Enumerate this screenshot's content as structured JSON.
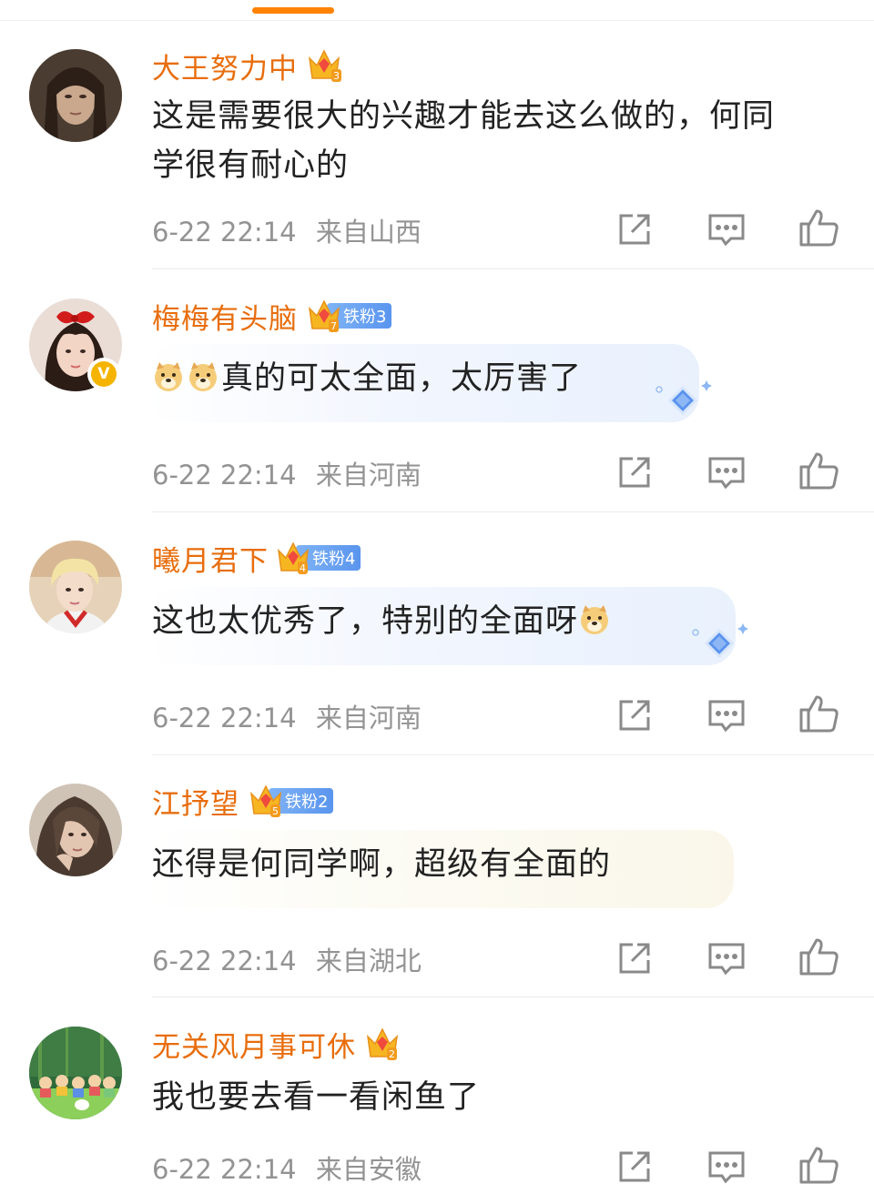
{
  "comments": [
    {
      "username": "大王努力中",
      "crown_level": "3",
      "fan_badge": "",
      "text_lines": [
        "这是需要很大的兴趣才能去这么做的，何同",
        "学很有耐心的"
      ],
      "time": "6-22 22:14",
      "location": "来自山西"
    },
    {
      "username": "梅梅有头脑",
      "crown_level": "7",
      "fan_badge": "铁粉3",
      "text_lines": [
        "真的可太全面，太厉害了"
      ],
      "time": "6-22 22:14",
      "location": "来自河南"
    },
    {
      "username": "曦月君下",
      "crown_level": "4",
      "fan_badge": "铁粉4",
      "text_lines": [
        "这也太优秀了，特别的全面呀"
      ],
      "time": "6-22 22:14",
      "location": "来自河南"
    },
    {
      "username": "江抒望",
      "crown_level": "5",
      "fan_badge": "铁粉2",
      "text_lines": [
        "还得是何同学啊，超级有全面的"
      ],
      "time": "6-22 22:14",
      "location": "来自湖北"
    },
    {
      "username": "无关风月事可休",
      "crown_level": "2",
      "fan_badge": "",
      "text_lines": [
        "我也要去看一看闲鱼了"
      ],
      "time": "6-22 22:14",
      "location": "来自安徽"
    }
  ],
  "icons": {
    "share": "share-icon",
    "comment": "comment-icon",
    "like": "like-icon",
    "verified": "verified-icon",
    "emoji": "doge-emoji-icon"
  },
  "verified_mark": "V",
  "colors": {
    "accent": "#ff8200",
    "username": "#e86d0c",
    "meta_text": "#939393",
    "fan_badge": "#6aa3f2",
    "verified": "#f5b400"
  }
}
